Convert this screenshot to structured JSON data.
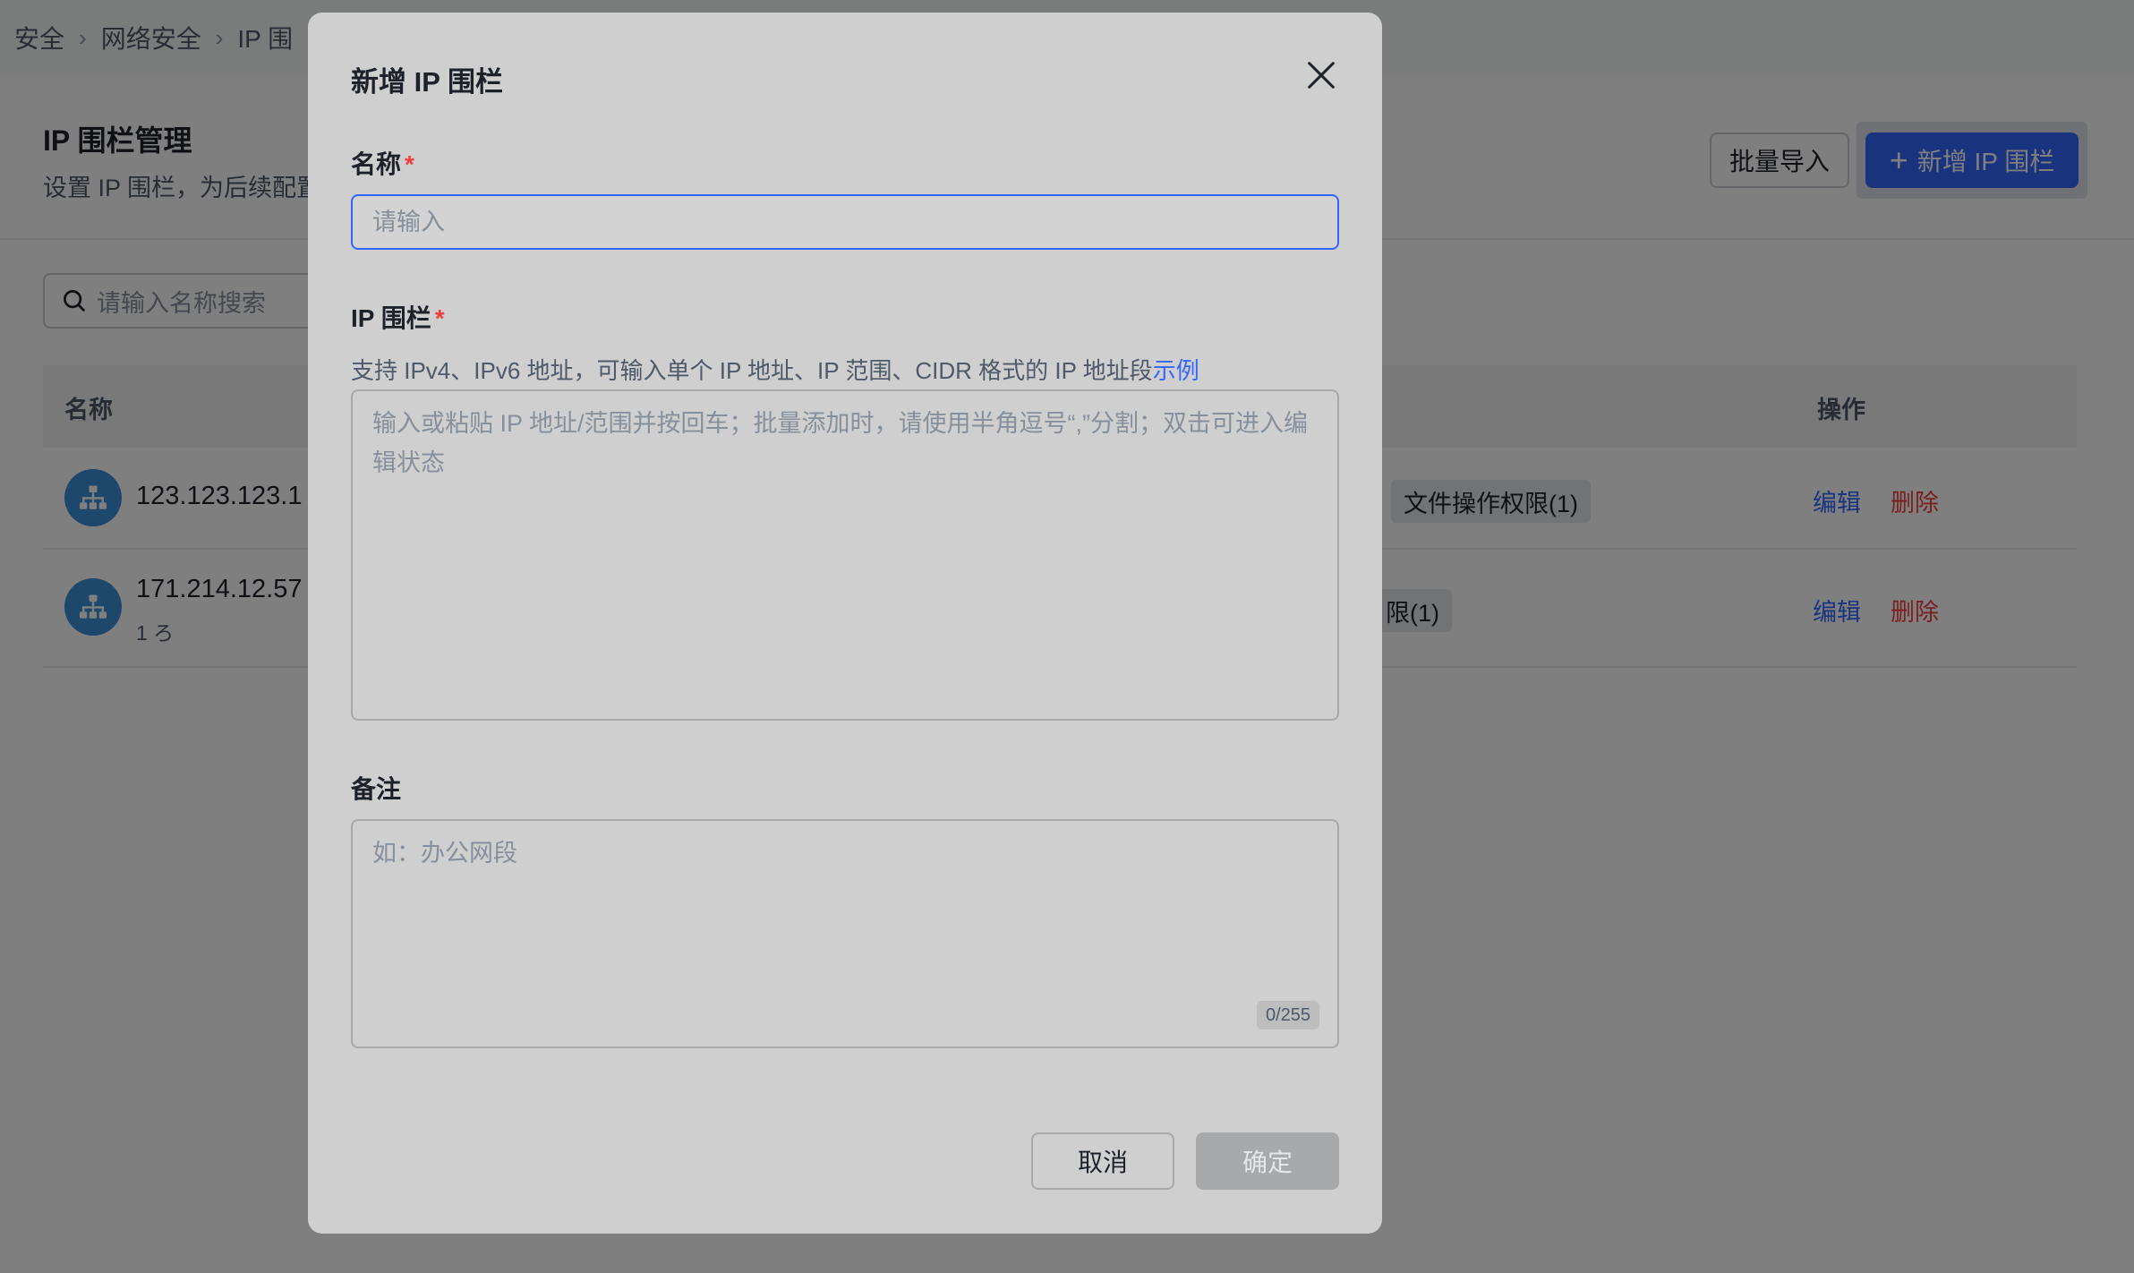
{
  "breadcrumb": [
    "安全",
    "网络安全",
    "IP 围"
  ],
  "header": {
    "title": "IP 围栏管理",
    "description": "设置 IP 围栏，为后续配置",
    "import_label": "批量导入",
    "add_label": "新增 IP 围栏",
    "add_icon": "plus-icon"
  },
  "search": {
    "placeholder": "请输入名称搜索"
  },
  "table": {
    "columns": {
      "name": "名称",
      "actions": "操作"
    },
    "rows": [
      {
        "name": "123.123.123.1",
        "sub": "",
        "tag": "文件操作权限(1)",
        "edit": "编辑",
        "delete": "删除"
      },
      {
        "name": "171.214.12.57",
        "sub": "1 ろ",
        "tag": "限(1)",
        "edit": "编辑",
        "delete": "删除"
      }
    ]
  },
  "modal": {
    "title": "新增 IP 围栏",
    "close_icon": "close-icon",
    "name_label": "名称",
    "name_placeholder": "请输入",
    "required_mark": "*",
    "ip_label": "IP 围栏",
    "ip_help": "支持 IPv4、IPv6 地址，可输入单个 IP 地址、IP 范围、CIDR 格式的 IP 地址段",
    "ip_help_link": "示例",
    "ip_placeholder": "输入或粘贴 IP 地址/范围并按回车；批量添加时，请使用半角逗号“,”分割；双击可进入编辑状态",
    "note_label": "备注",
    "note_placeholder": "如：办公网段",
    "note_counter": "0/255",
    "cancel_label": "取消",
    "confirm_label": "确定"
  },
  "colors": {
    "primary": "#3366ff",
    "danger": "#f53f3f",
    "mask": "rgba(0,0,0,0.5)"
  }
}
